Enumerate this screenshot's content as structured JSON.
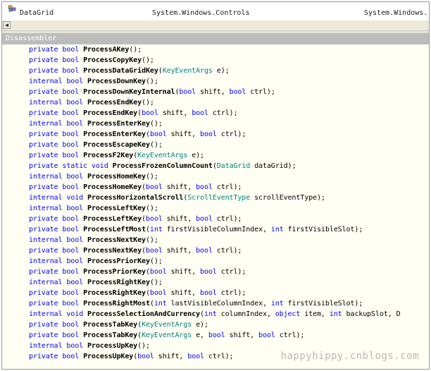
{
  "header": {
    "class_name": "DataGrid",
    "namespace": "System.Windows.Controls",
    "assembly": "System.Windows."
  },
  "panel": {
    "title": "Disassembler"
  },
  "watermark": "happyhippy.cnblogs.com",
  "code_lines": [
    [
      [
        "kw",
        "private "
      ],
      [
        "kw",
        "bool "
      ],
      [
        "m",
        "ProcessAKey"
      ],
      [
        "p",
        "();"
      ]
    ],
    [
      [
        "kw",
        "private "
      ],
      [
        "kw",
        "bool "
      ],
      [
        "m",
        "ProcessCopyKey"
      ],
      [
        "p",
        "();"
      ]
    ],
    [
      [
        "kw",
        "private "
      ],
      [
        "kw",
        "bool "
      ],
      [
        "m",
        "ProcessDataGridKey"
      ],
      [
        "p",
        "("
      ],
      [
        "t",
        "KeyEventArgs"
      ],
      [
        "p",
        " e);"
      ]
    ],
    [
      [
        "kw",
        "internal "
      ],
      [
        "kw",
        "bool "
      ],
      [
        "m",
        "ProcessDownKey"
      ],
      [
        "p",
        "();"
      ]
    ],
    [
      [
        "kw",
        "private "
      ],
      [
        "kw",
        "bool "
      ],
      [
        "m",
        "ProcessDownKeyInternal"
      ],
      [
        "p",
        "("
      ],
      [
        "kw",
        "bool"
      ],
      [
        "p",
        " shift, "
      ],
      [
        "kw",
        "bool"
      ],
      [
        "p",
        " ctrl);"
      ]
    ],
    [
      [
        "kw",
        "internal "
      ],
      [
        "kw",
        "bool "
      ],
      [
        "m",
        "ProcessEndKey"
      ],
      [
        "p",
        "();"
      ]
    ],
    [
      [
        "kw",
        "private "
      ],
      [
        "kw",
        "bool "
      ],
      [
        "m",
        "ProcessEndKey"
      ],
      [
        "p",
        "("
      ],
      [
        "kw",
        "bool"
      ],
      [
        "p",
        " shift, "
      ],
      [
        "kw",
        "bool"
      ],
      [
        "p",
        " ctrl);"
      ]
    ],
    [
      [
        "kw",
        "internal "
      ],
      [
        "kw",
        "bool "
      ],
      [
        "m",
        "ProcessEnterKey"
      ],
      [
        "p",
        "();"
      ]
    ],
    [
      [
        "kw",
        "private "
      ],
      [
        "kw",
        "bool "
      ],
      [
        "m",
        "ProcessEnterKey"
      ],
      [
        "p",
        "("
      ],
      [
        "kw",
        "bool"
      ],
      [
        "p",
        " shift, "
      ],
      [
        "kw",
        "bool"
      ],
      [
        "p",
        " ctrl);"
      ]
    ],
    [
      [
        "kw",
        "private "
      ],
      [
        "kw",
        "bool "
      ],
      [
        "m",
        "ProcessEscapeKey"
      ],
      [
        "p",
        "();"
      ]
    ],
    [
      [
        "kw",
        "private "
      ],
      [
        "kw",
        "bool "
      ],
      [
        "m",
        "ProcessF2Key"
      ],
      [
        "p",
        "("
      ],
      [
        "t",
        "KeyEventArgs"
      ],
      [
        "p",
        " e);"
      ]
    ],
    [
      [
        "kw",
        "private "
      ],
      [
        "kw",
        "static "
      ],
      [
        "kw",
        "void "
      ],
      [
        "m",
        "ProcessFrozenColumnCount"
      ],
      [
        "p",
        "("
      ],
      [
        "t",
        "DataGrid"
      ],
      [
        "p",
        " dataGrid);"
      ]
    ],
    [
      [
        "kw",
        "internal "
      ],
      [
        "kw",
        "bool "
      ],
      [
        "m",
        "ProcessHomeKey"
      ],
      [
        "p",
        "();"
      ]
    ],
    [
      [
        "kw",
        "private "
      ],
      [
        "kw",
        "bool "
      ],
      [
        "m",
        "ProcessHomeKey"
      ],
      [
        "p",
        "("
      ],
      [
        "kw",
        "bool"
      ],
      [
        "p",
        " shift, "
      ],
      [
        "kw",
        "bool"
      ],
      [
        "p",
        " ctrl);"
      ]
    ],
    [
      [
        "kw",
        "internal "
      ],
      [
        "kw",
        "void "
      ],
      [
        "m",
        "ProcessHorizontalScroll"
      ],
      [
        "p",
        "("
      ],
      [
        "t",
        "ScrollEventType"
      ],
      [
        "p",
        " scrollEventType);"
      ]
    ],
    [
      [
        "kw",
        "internal "
      ],
      [
        "kw",
        "bool "
      ],
      [
        "m",
        "ProcessLeftKey"
      ],
      [
        "p",
        "();"
      ]
    ],
    [
      [
        "kw",
        "private "
      ],
      [
        "kw",
        "bool "
      ],
      [
        "m",
        "ProcessLeftKey"
      ],
      [
        "p",
        "("
      ],
      [
        "kw",
        "bool"
      ],
      [
        "p",
        " shift, "
      ],
      [
        "kw",
        "bool"
      ],
      [
        "p",
        " ctrl);"
      ]
    ],
    [
      [
        "kw",
        "private "
      ],
      [
        "kw",
        "bool "
      ],
      [
        "m",
        "ProcessLeftMost"
      ],
      [
        "p",
        "("
      ],
      [
        "kw",
        "int"
      ],
      [
        "p",
        " firstVisibleColumnIndex, "
      ],
      [
        "kw",
        "int"
      ],
      [
        "p",
        " firstVisibleSlot);"
      ]
    ],
    [
      [
        "kw",
        "internal "
      ],
      [
        "kw",
        "bool "
      ],
      [
        "m",
        "ProcessNextKey"
      ],
      [
        "p",
        "();"
      ]
    ],
    [
      [
        "kw",
        "private "
      ],
      [
        "kw",
        "bool "
      ],
      [
        "m",
        "ProcessNextKey"
      ],
      [
        "p",
        "("
      ],
      [
        "kw",
        "bool"
      ],
      [
        "p",
        " shift, "
      ],
      [
        "kw",
        "bool"
      ],
      [
        "p",
        " ctrl);"
      ]
    ],
    [
      [
        "kw",
        "internal "
      ],
      [
        "kw",
        "bool "
      ],
      [
        "m",
        "ProcessPriorKey"
      ],
      [
        "p",
        "();"
      ]
    ],
    [
      [
        "kw",
        "private "
      ],
      [
        "kw",
        "bool "
      ],
      [
        "m",
        "ProcessPriorKey"
      ],
      [
        "p",
        "("
      ],
      [
        "kw",
        "bool"
      ],
      [
        "p",
        " shift, "
      ],
      [
        "kw",
        "bool"
      ],
      [
        "p",
        " ctrl);"
      ]
    ],
    [
      [
        "kw",
        "internal "
      ],
      [
        "kw",
        "bool "
      ],
      [
        "m",
        "ProcessRightKey"
      ],
      [
        "p",
        "();"
      ]
    ],
    [
      [
        "kw",
        "private "
      ],
      [
        "kw",
        "bool "
      ],
      [
        "m",
        "ProcessRightKey"
      ],
      [
        "p",
        "("
      ],
      [
        "kw",
        "bool"
      ],
      [
        "p",
        " shift, "
      ],
      [
        "kw",
        "bool"
      ],
      [
        "p",
        " ctrl);"
      ]
    ],
    [
      [
        "kw",
        "private "
      ],
      [
        "kw",
        "bool "
      ],
      [
        "m",
        "ProcessRightMost"
      ],
      [
        "p",
        "("
      ],
      [
        "kw",
        "int"
      ],
      [
        "p",
        " lastVisibleColumnIndex, "
      ],
      [
        "kw",
        "int"
      ],
      [
        "p",
        " firstVisibleSlot);"
      ]
    ],
    [
      [
        "kw",
        "internal "
      ],
      [
        "kw",
        "void "
      ],
      [
        "m",
        "ProcessSelectionAndCurrency"
      ],
      [
        "p",
        "("
      ],
      [
        "kw",
        "int"
      ],
      [
        "p",
        " columnIndex, "
      ],
      [
        "kw",
        "object"
      ],
      [
        "p",
        " item, "
      ],
      [
        "kw",
        "int"
      ],
      [
        "p",
        " backupSlot, D"
      ]
    ],
    [
      [
        "kw",
        "private "
      ],
      [
        "kw",
        "bool "
      ],
      [
        "m",
        "ProcessTabKey"
      ],
      [
        "p",
        "("
      ],
      [
        "t",
        "KeyEventArgs"
      ],
      [
        "p",
        " e);"
      ]
    ],
    [
      [
        "kw",
        "private "
      ],
      [
        "kw",
        "bool "
      ],
      [
        "m",
        "ProcessTabKey"
      ],
      [
        "p",
        "("
      ],
      [
        "t",
        "KeyEventArgs"
      ],
      [
        "p",
        " e, "
      ],
      [
        "kw",
        "bool"
      ],
      [
        "p",
        " shift, "
      ],
      [
        "kw",
        "bool"
      ],
      [
        "p",
        " ctrl);"
      ]
    ],
    [
      [
        "kw",
        "internal "
      ],
      [
        "kw",
        "bool "
      ],
      [
        "m",
        "ProcessUpKey"
      ],
      [
        "p",
        "();"
      ]
    ],
    [
      [
        "kw",
        "private "
      ],
      [
        "kw",
        "bool "
      ],
      [
        "m",
        "ProcessUpKey"
      ],
      [
        "p",
        "("
      ],
      [
        "kw",
        "bool"
      ],
      [
        "p",
        " shift, "
      ],
      [
        "kw",
        "bool"
      ],
      [
        "p",
        " ctrl);"
      ]
    ]
  ]
}
